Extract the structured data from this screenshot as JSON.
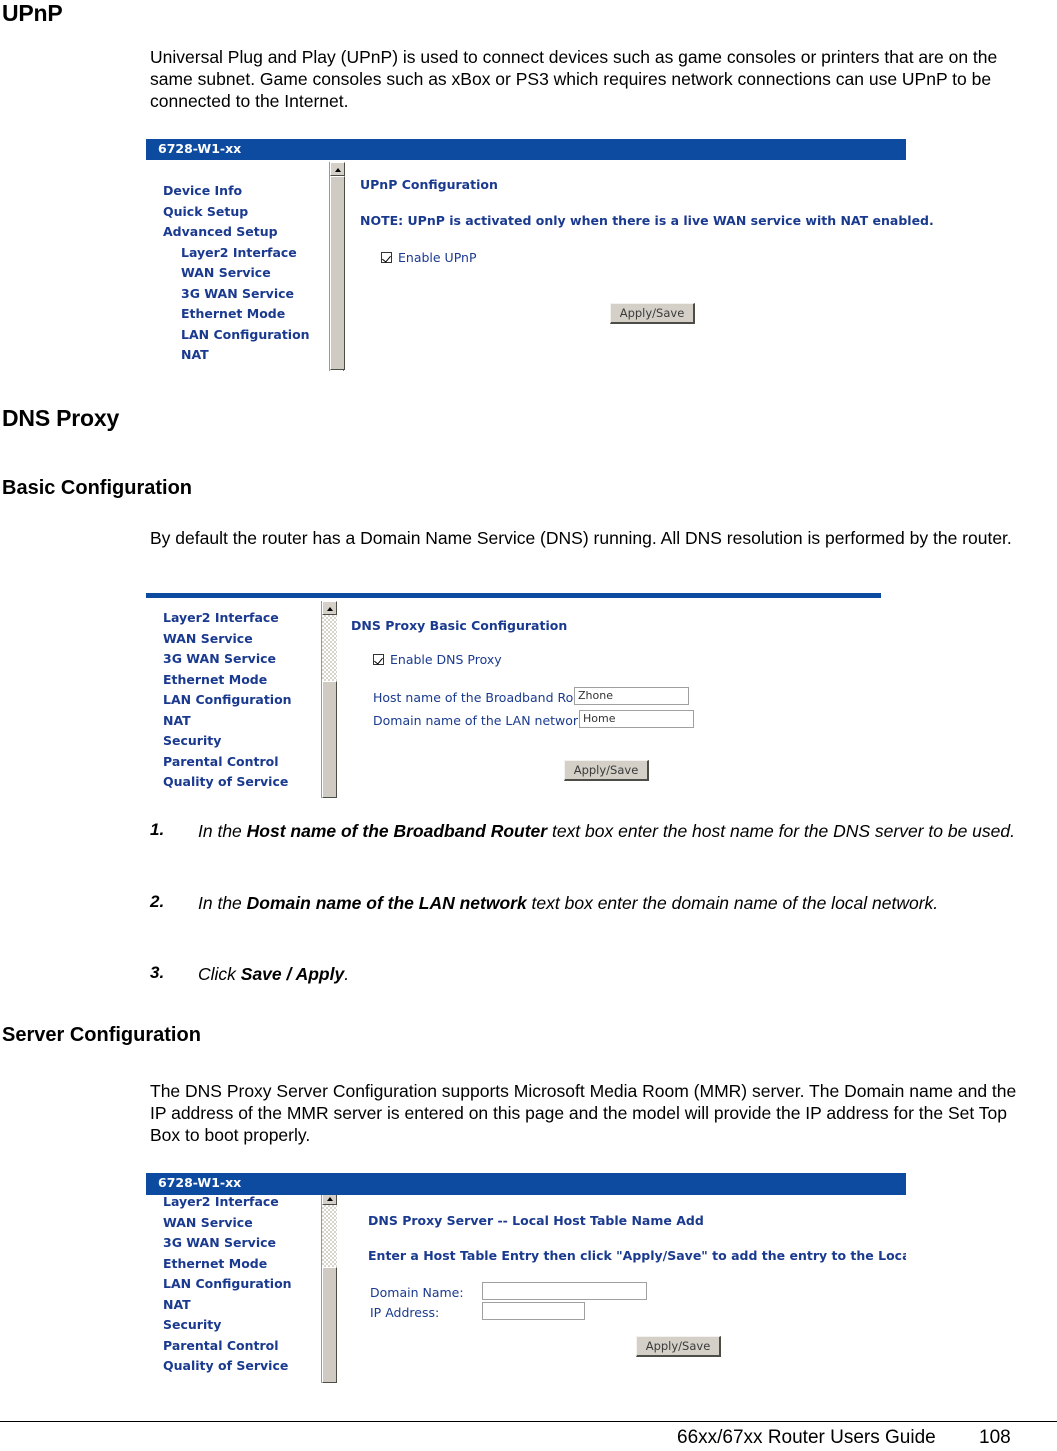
{
  "document": {
    "heading_upnp": "UPnP",
    "upnp_paragraph": "Universal Plug and Play (UPnP) is used to connect devices such as game consoles or printers that are on the same subnet.  Game consoles such as xBox or PS3 which requires network connections can use UPnP to be connected to the Internet.",
    "heading_dns_proxy": "DNS Proxy",
    "heading_basic_configuration": "Basic Configuration",
    "basic_paragraph": "By default the router has a Domain Name Service (DNS) running. All DNS resolution is performed by the router.",
    "steps": [
      {
        "num": "1.",
        "html": "In the <b>Host name of the Broadband Router</b> text box enter the host name for the DNS server to be used."
      },
      {
        "num": "2.",
        "html": "In the <b>Domain name of the LAN network</b> text box enter the domain name of the local network."
      },
      {
        "num": "3.",
        "html": "Click <b>Save / Apply</b>."
      }
    ],
    "heading_server_configuration": "Server Configuration",
    "server_paragraph": "The DNS Proxy Server Configuration supports Microsoft Media Room (MMR) server. The Domain name and the IP address of the MMR server is entered on this page and the model will provide the IP address for the Set Top Box to boot properly."
  },
  "footer": {
    "guide_title": "66xx/67xx Router Users Guide",
    "page_number": "108"
  },
  "colors": {
    "title_bar_blue": "#0d4ba0",
    "menu_link_blue": "#1a3a8f",
    "button_face": "#d4d0c8"
  },
  "screenshot_upnp": {
    "title_bar": "6728-W1-xx",
    "menu": [
      {
        "label": "Device Info",
        "indent": false
      },
      {
        "label": "Quick Setup",
        "indent": false
      },
      {
        "label": "Advanced Setup",
        "indent": false
      },
      {
        "label": "Layer2 Interface",
        "indent": true
      },
      {
        "label": "WAN Service",
        "indent": true
      },
      {
        "label": "3G WAN Service",
        "indent": true
      },
      {
        "label": "Ethernet Mode",
        "indent": true
      },
      {
        "label": "LAN Configuration",
        "indent": true
      },
      {
        "label": "NAT",
        "indent": true
      }
    ],
    "pane_title": "UPnP Configuration",
    "note": "NOTE:  UPnP is activated only when there is a live WAN service with NAT enabled.",
    "checkbox_label": "Enable UPnP",
    "checkbox_checked": true,
    "button_label": "Apply/Save"
  },
  "screenshot_dns_basic": {
    "menu": [
      {
        "label": "Layer2 Interface",
        "indent": false
      },
      {
        "label": "WAN Service",
        "indent": false
      },
      {
        "label": "3G WAN Service",
        "indent": false
      },
      {
        "label": "Ethernet Mode",
        "indent": false
      },
      {
        "label": "LAN Configuration",
        "indent": false
      },
      {
        "label": "NAT",
        "indent": false
      },
      {
        "label": "Security",
        "indent": false
      },
      {
        "label": "Parental Control",
        "indent": false
      },
      {
        "label": "Quality of Service",
        "indent": false
      }
    ],
    "pane_title": "DNS Proxy Basic Configuration",
    "checkbox_label": "Enable DNS Proxy",
    "checkbox_checked": true,
    "field_host_label": "Host name of the Broadband Router:",
    "field_host_value": "Zhone",
    "field_domain_label": "Domain name of the LAN network:",
    "field_domain_value": "Home",
    "button_label": "Apply/Save"
  },
  "screenshot_dns_server": {
    "title_bar": "6728-W1-xx",
    "menu": [
      {
        "label": "Layer2 Interface",
        "indent": false
      },
      {
        "label": "WAN Service",
        "indent": false
      },
      {
        "label": "3G WAN Service",
        "indent": false
      },
      {
        "label": "Ethernet Mode",
        "indent": false
      },
      {
        "label": "LAN Configuration",
        "indent": false
      },
      {
        "label": "NAT",
        "indent": false
      },
      {
        "label": "Security",
        "indent": false
      },
      {
        "label": "Parental Control",
        "indent": false
      },
      {
        "label": "Quality of Service",
        "indent": false
      }
    ],
    "pane_title": "DNS Proxy Server -- Local Host Table Name Add",
    "note": "Enter a Host Table Entry then click \"Apply/Save\" to add the entry to the Local Host Table.",
    "field_domain_label": "Domain Name:",
    "field_domain_value": "",
    "field_ip_label": "IP Address:",
    "field_ip_value": "",
    "button_label": "Apply/Save"
  }
}
